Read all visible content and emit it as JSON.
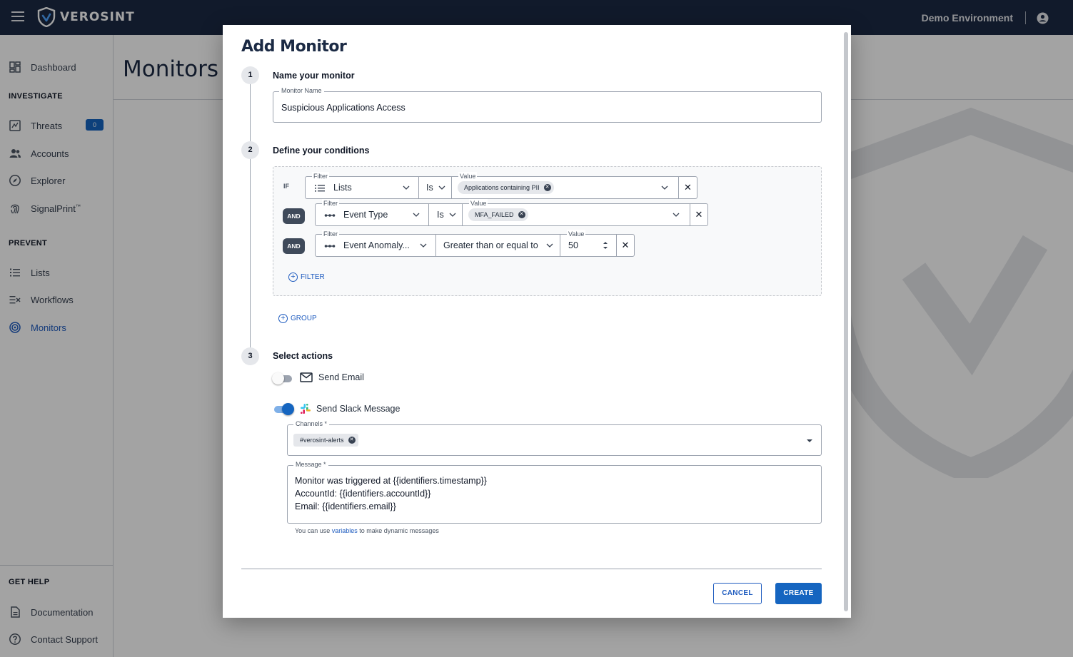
{
  "topbar": {
    "brand": "VEROSINT",
    "environment": "Demo Environment"
  },
  "sidebar": {
    "dashboard": "Dashboard",
    "section_investigate": "INVESTIGATE",
    "threats": "Threats",
    "threats_count": "0",
    "accounts": "Accounts",
    "explorer": "Explorer",
    "signalprint": "SignalPrint",
    "signalprint_tm": "™",
    "section_prevent": "PREVENT",
    "lists": "Lists",
    "workflows": "Workflows",
    "monitors": "Monitors",
    "section_help": "GET HELP",
    "documentation": "Documentation",
    "contact_support": "Contact Support"
  },
  "page": {
    "title": "Monitors"
  },
  "modal": {
    "title": "Add Monitor",
    "step1": {
      "number": "1",
      "title": "Name your monitor",
      "field_label": "Monitor Name",
      "field_value": "Suspicious Applications Access"
    },
    "step2": {
      "number": "2",
      "title": "Define your conditions",
      "if_label": "IF",
      "and_label": "AND",
      "filter_label": "Filter",
      "value_label": "Value",
      "rows": [
        {
          "filter": "Lists",
          "operator": "Is",
          "value_chip": "Applications containing PII"
        },
        {
          "filter": "Event Type",
          "operator": "Is",
          "value_chip": "MFA_FAILED"
        },
        {
          "filter": "Event Anomaly...",
          "operator": "Greater than or equal to",
          "value": "50"
        }
      ],
      "add_filter": "FILTER",
      "add_group": "GROUP"
    },
    "step3": {
      "number": "3",
      "title": "Select actions",
      "send_email": "Send Email",
      "send_email_on": false,
      "send_slack": "Send Slack Message",
      "send_slack_on": true,
      "channels_label": "Channels *",
      "channel_chip": "#verosint-alerts",
      "message_label": "Message *",
      "message_lines": [
        "Monitor was triggered at {{identifiers.timestamp}}",
        "AccountId: {{identifiers.accountId}}",
        "Email: {{identifiers.email}}"
      ],
      "helper_before": "You can use",
      "helper_link": "variables",
      "helper_after": "to make dynamic messages"
    },
    "cancel": "CANCEL",
    "create": "CREATE"
  },
  "colors": {
    "navy": "#1b2a44",
    "primary": "#1565c0",
    "link": "#1e5bbf"
  }
}
